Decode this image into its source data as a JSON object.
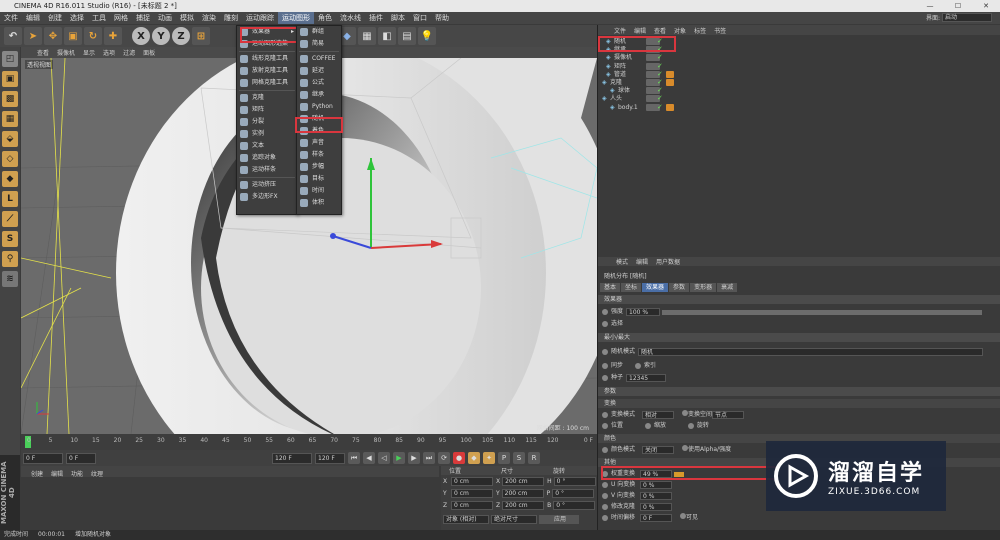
{
  "title": "CINEMA 4D R16.011 Studio (R16) - [未标题 2 *]",
  "window_buttons": [
    "—",
    "☐",
    "✕"
  ],
  "menubar": [
    "文件",
    "编辑",
    "创建",
    "选择",
    "工具",
    "网格",
    "捕捉",
    "动画",
    "模拟",
    "渲染",
    "雕刻",
    "运动跟踪",
    "运动图形",
    "角色",
    "流水线",
    "插件",
    "脚本",
    "窗口",
    "帮助"
  ],
  "menubar_active": "运动图形",
  "layout": {
    "label": "界面:",
    "value": "启动"
  },
  "toolbar_axes": [
    "X",
    "Y",
    "Z"
  ],
  "viewport": {
    "menu": [
      "查看",
      "摄像机",
      "显示",
      "选项",
      "过滤",
      "面板"
    ],
    "label": "透视视图",
    "grid_spacing": "网格间距 : 100 cm"
  },
  "menus": {
    "mograph": [
      {
        "label": "效果器",
        "sub": true
      },
      {
        "label": "运动图形选集"
      },
      {
        "sep": true
      },
      {
        "label": "线形克隆工具"
      },
      {
        "label": "放射克隆工具"
      },
      {
        "label": "网格克隆工具"
      },
      {
        "sep": true
      },
      {
        "label": "克隆"
      },
      {
        "label": "矩阵"
      },
      {
        "label": "分裂"
      },
      {
        "label": "实例"
      },
      {
        "label": "文本"
      },
      {
        "label": "追踪对象"
      },
      {
        "label": "运动样条"
      },
      {
        "sep": true
      },
      {
        "label": "运动挤压"
      },
      {
        "label": "多边形FX"
      }
    ],
    "effectors": [
      {
        "label": "群组"
      },
      {
        "label": "简易"
      },
      {
        "sep": true
      },
      {
        "label": "COFFEE"
      },
      {
        "label": "延迟"
      },
      {
        "label": "公式"
      },
      {
        "label": "继承"
      },
      {
        "label": "Python"
      },
      {
        "label": "随机"
      },
      {
        "label": "着色"
      },
      {
        "label": "声音"
      },
      {
        "label": "样条"
      },
      {
        "label": "步幅"
      },
      {
        "label": "目标"
      },
      {
        "label": "时间"
      },
      {
        "label": "体积"
      }
    ]
  },
  "timeline": {
    "ticks": [
      "0",
      "5",
      "10",
      "15",
      "20",
      "25",
      "30",
      "35",
      "40",
      "45",
      "50",
      "55",
      "60",
      "65",
      "70",
      "75",
      "80",
      "85",
      "90",
      "95",
      "100",
      "105",
      "110",
      "115",
      "120"
    ],
    "end_label": "0 F"
  },
  "transport": {
    "start": "0 F",
    "current": "0 F",
    "end": "120 F",
    "end2": "120 F"
  },
  "material": {
    "tabs": [
      "创建",
      "编辑",
      "功能",
      "纹理"
    ]
  },
  "maxon": "MAXON CINEMA 4D",
  "coords": {
    "headers": [
      "位置",
      "尺寸",
      "旋转"
    ],
    "rows": [
      {
        "axis": "X",
        "pos": "0 cm",
        "size": "200 cm",
        "rl": "H",
        "rot": "0 °"
      },
      {
        "axis": "Y",
        "pos": "0 cm",
        "size": "200 cm",
        "rl": "P",
        "rot": "0 °"
      },
      {
        "axis": "Z",
        "pos": "0 cm",
        "size": "200 cm",
        "rl": "B",
        "rot": "0 °"
      }
    ],
    "mode": "对象 (相对)",
    "size_mode": "绝对尺寸",
    "apply": "应用"
  },
  "status": {
    "time": "00:00:01",
    "text": "增加随机对象"
  },
  "status_prefix": "完成时间",
  "objects": {
    "menu": [
      "文件",
      "编辑",
      "查看",
      "对象",
      "标签",
      "书签"
    ],
    "items": [
      {
        "name": "随机",
        "indent": 1,
        "tag": false
      },
      {
        "name": "继承",
        "indent": 1,
        "tag": false
      },
      {
        "name": "摄像机",
        "indent": 1,
        "tag": false
      },
      {
        "name": "矩阵",
        "indent": 1,
        "tag": false
      },
      {
        "name": "管道",
        "indent": 1,
        "tag": true
      },
      {
        "name": "克隆",
        "indent": 0,
        "tag": true
      },
      {
        "name": "球体",
        "indent": 2,
        "tag": false
      },
      {
        "name": "人头",
        "indent": 0,
        "tag": false
      },
      {
        "name": "body.1",
        "indent": 2,
        "tag": true
      }
    ]
  },
  "attributes": {
    "menu": [
      "模式",
      "编辑",
      "用户数据"
    ],
    "object_title": "随机分布 [随机]",
    "tabs": [
      "基本",
      "坐标",
      "效果器",
      "参数",
      "变形器",
      "衰减"
    ],
    "selected_tab": "效果器",
    "sections": {
      "effector": "效果器",
      "minmax": "最小/最大",
      "params": "参数",
      "transform": "变换",
      "color": "颜色",
      "other": "其他"
    },
    "strength_label": "强度",
    "strength_value": "100 %",
    "strength": 1.0,
    "selection_label": "选择",
    "random_mode_label": "随机模式",
    "random_mode_value": "随机",
    "sync_label": "同步",
    "index_label": "索引",
    "seed_label": "种子",
    "seed_value": "12345",
    "transform_mode_label": "变换模式",
    "transform_mode_value": "相对",
    "transform_space_label": "变换空间",
    "transform_space_value": "节点",
    "pos_label": "位置",
    "scale_label": "缩放",
    "rot_label": "旋转",
    "color_mode_label": "颜色模式",
    "color_mode_value": "关闭",
    "use_alpha_label": "使用Alpha/强度",
    "weight_label": "权重变换",
    "weight_value": "49 %",
    "weight": 0.49,
    "u_label": "U 向变换",
    "u_value": "0 %",
    "v_label": "V 向变换",
    "v_value": "0 %",
    "mod_label": "修改克隆",
    "mod_value": "0 %",
    "time_label": "时间偏移",
    "time_value": "0 F",
    "visible_label": "可见"
  },
  "watermark": {
    "title": "溜溜自学",
    "url": "ZIXUE.3D66.COM"
  },
  "colors": {
    "accent": "#4a6ea6",
    "highlight": "#d9363e",
    "check": "#6cdc5a"
  }
}
